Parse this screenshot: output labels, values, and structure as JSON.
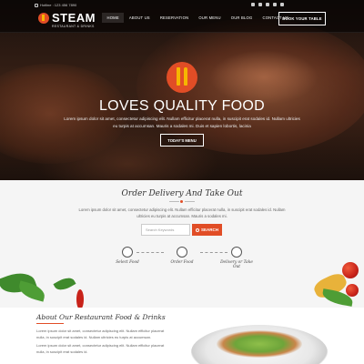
{
  "header": {
    "hotline_label": "Hotline : 123 456 7890",
    "logo_text": "STEAM",
    "logo_sub": "RESTAURANT & DRINKS",
    "menu": [
      {
        "label": "HOME",
        "active": true
      },
      {
        "label": "ABOUT US"
      },
      {
        "label": "RESERVATION"
      },
      {
        "label": "OUR MENU"
      },
      {
        "label": "OUR BLOG"
      },
      {
        "label": "CONTACT US"
      }
    ],
    "book_button": "BOOK YOUR TABLE",
    "social_icons": [
      "facebook-icon",
      "twitter-icon",
      "google-plus-icon",
      "instagram-icon",
      "pinterest-icon"
    ]
  },
  "hero": {
    "title": "LOVES QUALITY FOOD",
    "text": "Lorem ipsum dolor sit amet, consectetur adipiscing elit. Nullam efficitur placerat nulla, in suscipit erat sodales id. Nullam ultricies eu turpis at accumsan. Mauris a sodales mi. Duis et sapien lobortis, lacinia",
    "button": "TODAY'S MENU"
  },
  "order": {
    "title": "Order Delivery And Take Out",
    "text": "Lorem ipsum dolor sit amet, consectetur adipiscing elit. Nullam efficitur placerat nulla, in suscipit erat sodales id. Nullam ultricies eu turpis at accumsan. Mauris a sodales mi.",
    "search_placeholder": "Search Keywords",
    "search_button": "SEARCH",
    "steps": [
      "Select Food",
      "Order Food",
      "Delivery or Take Out"
    ]
  },
  "about": {
    "title": "About Our Restaurant Food & Drinks",
    "paragraph1": "Lorem ipsum dolor sit amet, consectetur adipiscing elit. Nullam efficitur placerat nulla, in suscipit erat sodales id. Nullam ultricies eu turpis at accumsan.",
    "paragraph2": "Lorem ipsum dolor sit amet, consectetur adipiscing elit. Nullam efficitur placerat nulla, in suscipit erat sodales id."
  },
  "colors": {
    "accent": "#e14d26",
    "logo_yellow": "#f6b500"
  }
}
